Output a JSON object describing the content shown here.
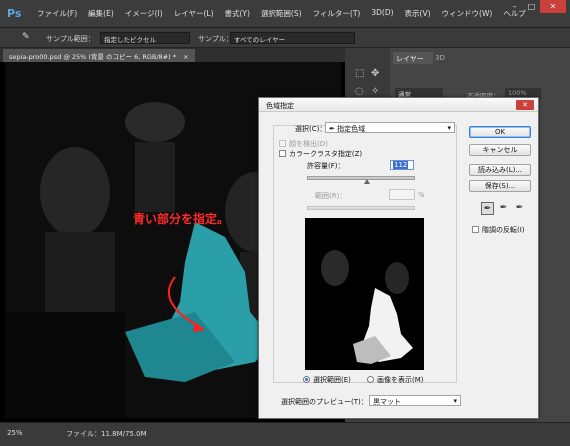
{
  "app": {
    "logo": "Ps"
  },
  "menu": [
    "ファイル(F)",
    "編集(E)",
    "イメージ(I)",
    "レイヤー(L)",
    "書式(Y)",
    "選択範囲(S)",
    "フィルター(T)",
    "3D(D)",
    "表示(V)",
    "ウィンドウ(W)",
    "ヘルプ"
  ],
  "window_buttons": {
    "minimize": "–",
    "maximize": "□",
    "close": "✕"
  },
  "options_bar": {
    "tool_icon": "eyedropper-icon",
    "sample_size_label": "サンプル範囲：",
    "sample_size_value": "指定したピクセル",
    "sample_label": "サンプル：",
    "sample_value": "すべてのレイヤー"
  },
  "document_tab": {
    "title": "sepia-pro00.psd @ 25% (背景 のコピー 6, RGB/8#) *",
    "close": "×"
  },
  "annotation": "青い部分を指定。",
  "layers_panel": {
    "tab_layers": "レイヤー",
    "tab_3d": "3D",
    "kind_select": "通常",
    "opacity_label": "不透明度：",
    "opacity_value": "100%"
  },
  "status_bar": {
    "zoom": "25%",
    "file_info": "ファイル：11.8M/75.0M"
  },
  "dialog": {
    "title": "色域指定",
    "close": "✕",
    "select_label": "選択(C)：",
    "select_value": "指定色域",
    "detect_faces": "顔を検出(D)",
    "localized_clusters": "カラークラスタ指定(Z)",
    "fuzziness_label": "許容量(F)：",
    "fuzziness_value": "112",
    "range_label": "範囲(R)：",
    "range_unit": "%",
    "radio_selection": "選択範囲(E)",
    "radio_image": "画像を表示(M)",
    "preview_label": "選択範囲のプレビュー(T)：",
    "preview_value": "黒マット",
    "buttons": {
      "ok": "OK",
      "cancel": "キャンセル",
      "load": "読み込み(L)...",
      "save": "保存(S)..."
    },
    "invert_label": "階調の反転(I)",
    "fuzziness_fraction": 0.56
  }
}
